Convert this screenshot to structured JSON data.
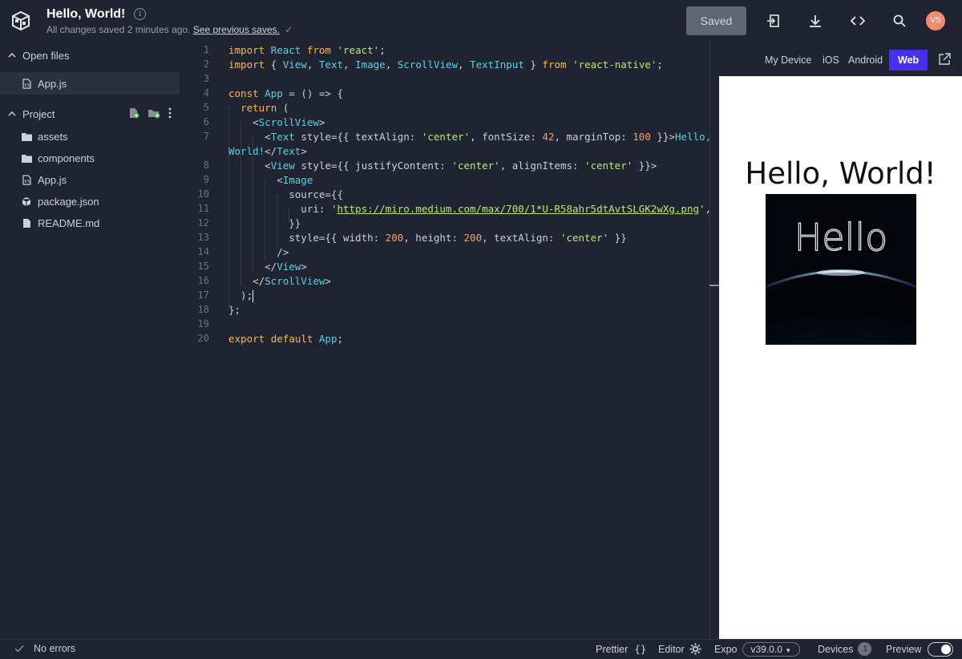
{
  "header": {
    "title": "Hello, World!",
    "subtitle_text": "All changes saved 2 minutes ago.",
    "subtitle_link": "See previous saves.",
    "saved_label": "Saved",
    "avatar_initials": "VS",
    "colors": {
      "accent": "#4630eb",
      "saved_bg": "#5f6673",
      "avatar": "#f28b6f"
    }
  },
  "sidebar": {
    "open_files_label": "Open files",
    "open_files": [
      {
        "name": "App.js",
        "icon": "js-file-icon"
      }
    ],
    "project_label": "Project",
    "project_items": [
      {
        "name": "assets",
        "icon": "folder-icon"
      },
      {
        "name": "components",
        "icon": "folder-icon"
      },
      {
        "name": "App.js",
        "icon": "js-file-icon"
      },
      {
        "name": "package.json",
        "icon": "package-icon"
      },
      {
        "name": "README.md",
        "icon": "document-icon"
      }
    ]
  },
  "editor": {
    "line_numbers": [
      "1",
      "2",
      "3",
      "4",
      "5",
      "6",
      "7",
      "8",
      "9",
      "10",
      "11",
      "12",
      "13",
      "14",
      "15",
      "16",
      "17",
      "18",
      "19",
      "20"
    ],
    "code": [
      "import React from 'react';",
      "import { View, Text, Image, ScrollView, TextInput } from 'react-native';",
      "",
      "const App = () => {",
      "  return (",
      "    <ScrollView>",
      "      <Text style={{ textAlign: 'center', fontSize: 42, marginTop: 100 }}>Hello,",
      "World!</Text>",
      "      <View style={{ justifyContent: 'center', alignItems: 'center' }}>",
      "        <Image",
      "          source={{",
      "            uri: 'https://miro.medium.com/max/700/1*U-R58ahr5dtAvtSLGK2wXg.png',",
      "          }}",
      "          style={{ width: 200, height: 200, textAlign: 'center' }}",
      "        />",
      "      </View>",
      "    </ScrollView>",
      "  );",
      "};",
      "",
      "export default App;"
    ]
  },
  "preview": {
    "tabs": [
      "My Device",
      "iOS",
      "Android",
      "Web"
    ],
    "active_tab": "Web",
    "hello_text": "Hello, World!",
    "image_text": "Hello"
  },
  "statusbar": {
    "errors": "No errors",
    "prettier": "Prettier",
    "editor": "Editor",
    "expo": "Expo",
    "version": "v39.0.0",
    "devices": "Devices",
    "devices_count": "1",
    "preview": "Preview"
  }
}
